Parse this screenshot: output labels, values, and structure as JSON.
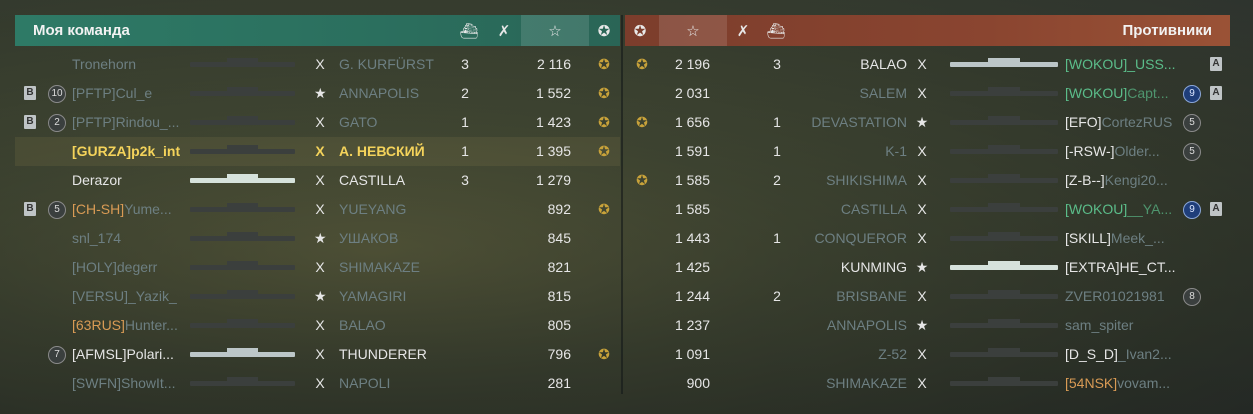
{
  "left": {
    "title": "Моя команда",
    "headers": {
      "planes_icon": "planes-shot-icon",
      "kills_icon": "kills-icon",
      "xp_icon": "☆",
      "medal_icon": "medal-icon"
    },
    "rows": [
      {
        "rank": "",
        "clan": "",
        "name": "Tronehorn",
        "ship": "G. KURFÜRST",
        "mark": "X",
        "kills": "3",
        "xp": "2 116",
        "medal": true,
        "state": "dead",
        "side": "",
        "badge": ""
      },
      {
        "rank": "10",
        "clan": "[PFTP]",
        "name": "Cul_e",
        "ship": "ANNAPOLIS",
        "mark": "★",
        "kills": "2",
        "xp": "1 552",
        "medal": true,
        "state": "dead",
        "side": "B",
        "badge": ""
      },
      {
        "rank": "2",
        "clan": "[PFTP]",
        "name": "Rindou_...",
        "ship": "GATO",
        "mark": "X",
        "kills": "1",
        "xp": "1 423",
        "medal": true,
        "state": "dead",
        "side": "B",
        "badge": ""
      },
      {
        "rank": "",
        "clan": "[GURZA]",
        "name": "p2k_int",
        "ship": "А. НЕВСКИЙ",
        "mark": "X",
        "kills": "1",
        "xp": "1 395",
        "medal": true,
        "state": "me",
        "side": "",
        "badge": ""
      },
      {
        "rank": "",
        "clan": "",
        "name": "Derazor",
        "ship": "CASTILLA",
        "mark": "X",
        "kills": "3",
        "xp": "1 279",
        "medal": false,
        "state": "alive",
        "side": "",
        "badge": ""
      },
      {
        "rank": "5",
        "clan": "[CH-SH]",
        "name": "Yume...",
        "ship": "YUEYANG",
        "mark": "X",
        "kills": "",
        "xp": "892",
        "medal": true,
        "state": "deadorange",
        "side": "B",
        "badge": ""
      },
      {
        "rank": "",
        "clan": "",
        "name": "snl_174",
        "ship": "УШАКОВ",
        "mark": "★",
        "kills": "",
        "xp": "845",
        "medal": false,
        "state": "dead",
        "side": "",
        "badge": ""
      },
      {
        "rank": "",
        "clan": "[HOLY]",
        "name": "degerr",
        "ship": "SHIMAKAZE",
        "mark": "X",
        "kills": "",
        "xp": "821",
        "medal": false,
        "state": "dead",
        "side": "",
        "badge": ""
      },
      {
        "rank": "",
        "clan": "[VERSU]",
        "name": "_Yazik_",
        "ship": "YAMAGIRI",
        "mark": "★",
        "kills": "",
        "xp": "815",
        "medal": false,
        "state": "dead",
        "side": "",
        "badge": ""
      },
      {
        "rank": "",
        "clan": "[63RUS]",
        "name": "Hunter...",
        "ship": "BALAO",
        "mark": "X",
        "kills": "",
        "xp": "805",
        "medal": false,
        "state": "deadorange",
        "side": "",
        "badge": ""
      },
      {
        "rank": "7",
        "clan": "[AFMSL]",
        "name": "Polari...",
        "ship": "THUNDERER",
        "mark": "X",
        "kills": "",
        "xp": "796",
        "medal": true,
        "state": "alive",
        "side": "",
        "badge": ""
      },
      {
        "rank": "",
        "clan": "[SWFN]",
        "name": "ShowIt...",
        "ship": "NAPOLI",
        "mark": "X",
        "kills": "",
        "xp": "281",
        "medal": false,
        "state": "dead",
        "side": "",
        "badge": ""
      }
    ]
  },
  "right": {
    "title": "Противники",
    "rows": [
      {
        "medal": true,
        "xp": "2 196",
        "kills": "3",
        "ship": "BALAO",
        "mark": "X",
        "clan": "[WOKOU]",
        "name": "_USS...",
        "rank": "",
        "side": "A",
        "state": "alive-ally"
      },
      {
        "medal": false,
        "xp": "2 031",
        "kills": "",
        "ship": "SALEM",
        "mark": "X",
        "clan": "[WOKOU]",
        "name": "Capt...",
        "rank": "9",
        "side": "A",
        "state": "dead-ally"
      },
      {
        "medal": true,
        "xp": "1 656",
        "kills": "1",
        "ship": "DEVASTATION",
        "mark": "★",
        "clan": "[EFO]",
        "name": "CortezRUS",
        "rank": "5",
        "side": "",
        "state": "dead"
      },
      {
        "medal": false,
        "xp": "1 591",
        "kills": "1",
        "ship": "K-1",
        "mark": "X",
        "clan": "[-RSW-]",
        "name": "Older...",
        "rank": "5",
        "side": "",
        "state": "dead"
      },
      {
        "medal": true,
        "xp": "1 585",
        "kills": "2",
        "ship": "SHIKISHIMA",
        "mark": "X",
        "clan": "[Z-B--]",
        "name": "Kengi20...",
        "rank": "",
        "side": "",
        "state": "dead"
      },
      {
        "medal": false,
        "xp": "1 585",
        "kills": "",
        "ship": "CASTILLA",
        "mark": "X",
        "clan": "[WOKOU]",
        "name": "__YA...",
        "rank": "9",
        "side": "A",
        "state": "dead-ally"
      },
      {
        "medal": false,
        "xp": "1 443",
        "kills": "1",
        "ship": "CONQUEROR",
        "mark": "X",
        "clan": "[SKILL]",
        "name": "Meek_...",
        "rank": "",
        "side": "",
        "state": "dead"
      },
      {
        "medal": false,
        "xp": "1 425",
        "kills": "",
        "ship": "KUNMING",
        "mark": "★",
        "clan": "[EXTRA]",
        "name": "HE_CT...",
        "rank": "",
        "side": "",
        "state": "alive"
      },
      {
        "medal": false,
        "xp": "1 244",
        "kills": "2",
        "ship": "BRISBANE",
        "mark": "X",
        "clan": "",
        "name": "ZVER01021981",
        "rank": "8",
        "side": "",
        "state": "dead"
      },
      {
        "medal": false,
        "xp": "1 237",
        "kills": "",
        "ship": "ANNAPOLIS",
        "mark": "★",
        "clan": "",
        "name": "sam_spiter",
        "rank": "",
        "side": "",
        "state": "dead"
      },
      {
        "medal": false,
        "xp": "1 091",
        "kills": "",
        "ship": "Z-52",
        "mark": "X",
        "clan": "[D_S_D]",
        "name": "_Ivan2...",
        "rank": "",
        "side": "",
        "state": "dead"
      },
      {
        "medal": false,
        "xp": "900",
        "kills": "",
        "ship": "SHIMAKAZE",
        "mark": "X",
        "clan": "[54NSK]",
        "name": "vovam...",
        "rank": "",
        "side": "",
        "state": "deadorange"
      }
    ]
  }
}
